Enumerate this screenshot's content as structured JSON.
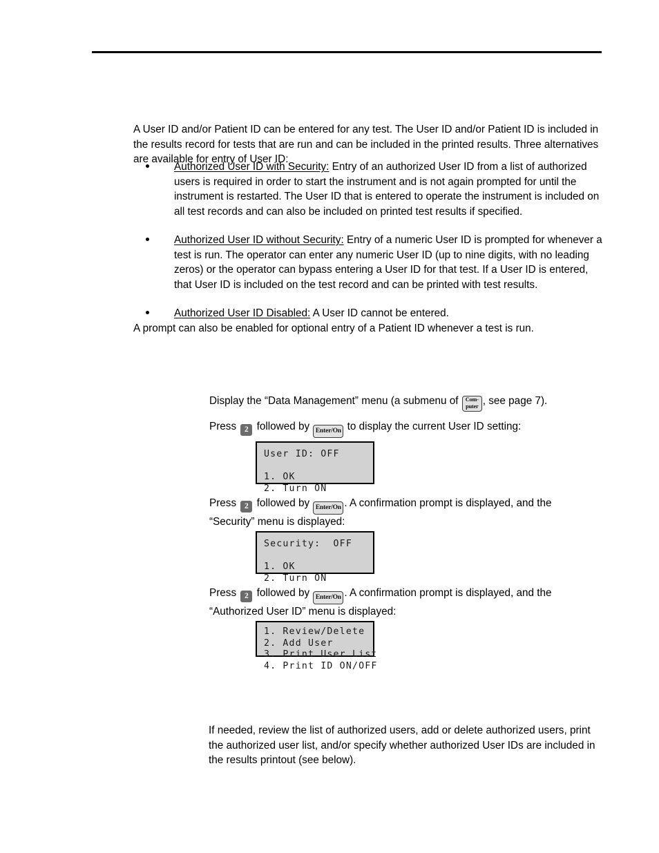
{
  "document": {
    "header_rule": true
  },
  "intro": {
    "paragraph": "A User ID and/or Patient ID can be entered for any test. The User ID and/or Patient ID is included in the results record for tests that are run and can be included in the printed results. Three alternatives are available for entry of User ID:"
  },
  "bullets": [
    {
      "lead": "Authorized User ID with Security:",
      "body": "  Entry of an authorized User ID from a list of authorized users is required in order to start the instrument and is not again prompted for until the instrument is restarted. The User ID that is entered to operate the instrument is included on all test records and can also be included on printed test results if specified."
    },
    {
      "lead": "Authorized User ID without Security:",
      "body": "  Entry of a numeric User ID is prompted for whenever a test is run. The operator can enter any numeric User ID (up to nine digits, with no leading zeros) or the operator can bypass entering a User ID for that test. If a User ID is entered, that User ID is included on the test record and can be printed with test results."
    },
    {
      "lead": "Authorized User ID Disabled:",
      "body": "  A User ID cannot be entered."
    }
  ],
  "closing": {
    "paragraph": "A prompt can also be enabled for optional entry of a Patient ID whenever a test is run."
  },
  "steps": {
    "step1": {
      "text_before": "Display the “Data Management” menu (a submenu of ",
      "key_computer_line1": "Com-",
      "key_computer_line2": "puter",
      "text_after": ", see page 7)."
    },
    "step2": {
      "text_before": "Press ",
      "key_number": "2",
      "text_middle": " followed by ",
      "key_enter": "Enter/On",
      "text_after": " to display the current User ID setting:"
    },
    "step3": {
      "text_before": "Press ",
      "key_number": "2",
      "text_middle": " followed by ",
      "key_enter": "Enter/On",
      "text_after": ". A confirmation prompt is displayed, and the “Security” menu is displayed:"
    },
    "step4": {
      "text_before": "Press ",
      "key_number": "2",
      "text_middle": " followed by ",
      "key_enter": "Enter/On",
      "text_after": ". A confirmation prompt is displayed, and the “Authorized User ID” menu is displayed:"
    }
  },
  "lcd_screens": [
    {
      "name": "user-id-menu",
      "lines": [
        "User ID: OFF",
        "",
        "1. OK",
        "2. Turn ON"
      ]
    },
    {
      "name": "security-menu",
      "lines": [
        "Security:  OFF",
        "",
        "1. OK",
        "2. Turn ON"
      ]
    },
    {
      "name": "authorized-user-id-menu",
      "lines": [
        "1. Review/Delete",
        "2. Add User",
        "3. Print User List",
        "4. Print ID ON/OFF"
      ]
    }
  ],
  "footer": {
    "paragraph": "If needed, review the list of authorized users, add or delete authorized users, print the authorized user list, and/or specify whether authorized User IDs are included in the results printout (see below)."
  },
  "colors": {
    "lcd_background": "#d2d2d2",
    "lcd_border": "#000000",
    "key_number_background": "#6b6b6b",
    "key_box_background": "#e2e2e2",
    "text": "#000000"
  }
}
